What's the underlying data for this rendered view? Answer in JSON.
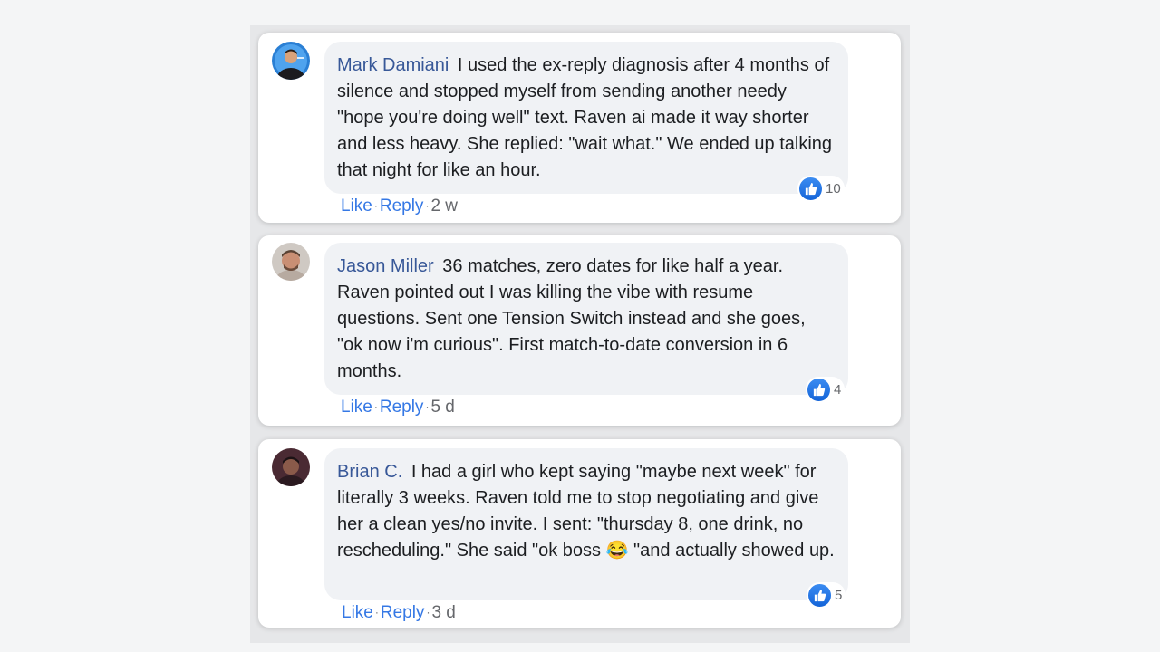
{
  "comments": [
    {
      "author": "Mark Damiani",
      "text": "I used the ex-reply diagnosis after 4 months of silence and stopped myself from sending another needy \"hope you're doing well\" text. Raven ai made it way shorter and less heavy. She replied: \"wait what.\" We ended up talking that night for like an hour.",
      "reaction_count": "10",
      "like_label": "Like",
      "reply_label": "Reply",
      "time": "2 w"
    },
    {
      "author": "Jason Miller",
      "text": "36 matches, zero dates for like half a year. Raven pointed out I was killing the vibe with resume questions. Sent one Tension Switch instead and she goes, \"ok now i'm curious\". First match-to-date conversion in 6 months.",
      "reaction_count": "4",
      "like_label": "Like",
      "reply_label": "Reply",
      "time": "5 d"
    },
    {
      "author": "Brian C.",
      "text": "I had a girl who kept saying \"maybe next week\" for literally 3 weeks. Raven told me to stop negotiating and give her a clean yes/no invite. I sent: \"thursday 8, one drink, no rescheduling.\" She said \"ok boss 😂 \"and actually showed up.",
      "reaction_count": "5",
      "like_label": "Like",
      "reply_label": "Reply",
      "time": "3 d"
    }
  ],
  "colors": {
    "author": "#385898",
    "link": "#3578e5",
    "bubble": "#f0f2f5",
    "like": "#1877f2"
  },
  "icons": {
    "reaction": "thumbs-up-icon",
    "separator": "dot"
  }
}
